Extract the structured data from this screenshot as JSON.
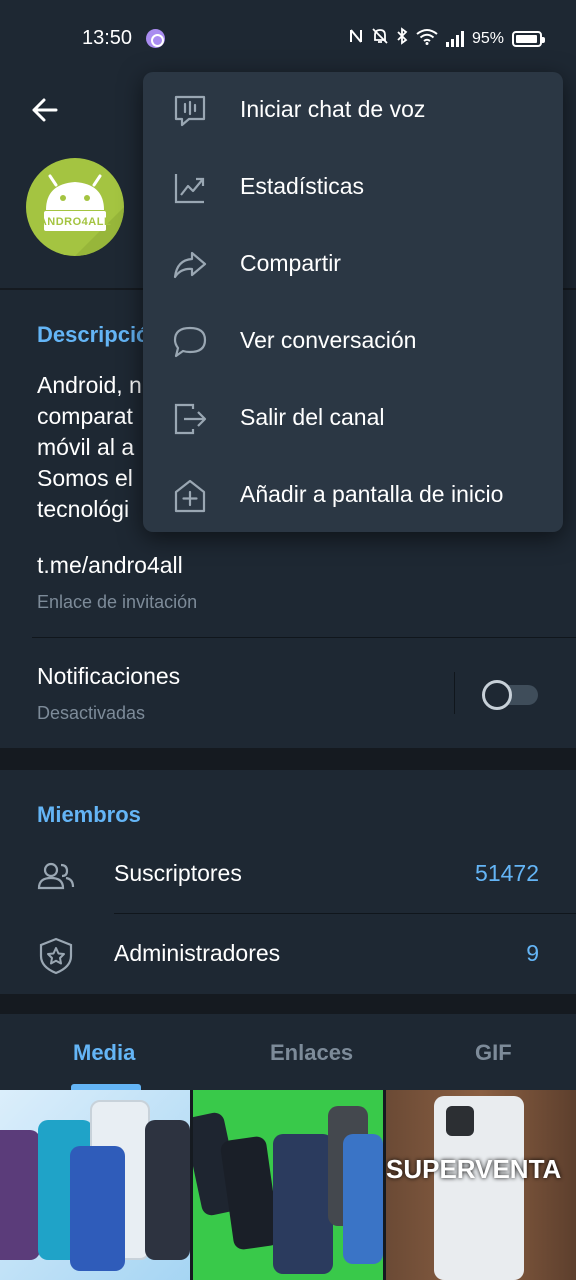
{
  "status_bar": {
    "time": "13:50",
    "battery": "95%"
  },
  "channel": {
    "avatar_text": "ANDRO4ALL",
    "description_title": "Descripció",
    "description_lines": [
      "Android, n",
      "comparat",
      "móvil al a",
      "Somos el",
      "tecnológi"
    ],
    "link": "t.me/andro4all",
    "link_sub": "Enlace de invitación",
    "notifications_label": "Notificaciones",
    "notifications_sub": "Desactivadas"
  },
  "members": {
    "title": "Miembros",
    "rows": [
      {
        "label": "Suscriptores",
        "count": "51472",
        "icon": "users-icon"
      },
      {
        "label": "Administradores",
        "count": "9",
        "icon": "shield-star-icon"
      }
    ]
  },
  "tabs": {
    "items": [
      "Media",
      "Enlaces",
      "GIF"
    ],
    "active": "Media"
  },
  "media": {
    "overlay_text": "SUPERVENTA"
  },
  "menu": {
    "items": [
      {
        "label": "Iniciar chat de voz",
        "icon": "voice-chat-icon"
      },
      {
        "label": "Estadísticas",
        "icon": "statistics-icon"
      },
      {
        "label": "Compartir",
        "icon": "share-icon"
      },
      {
        "label": "Ver conversación",
        "icon": "chat-bubble-icon"
      },
      {
        "label": "Salir del canal",
        "icon": "leave-icon"
      },
      {
        "label": "Añadir a pantalla de inicio",
        "icon": "add-home-icon"
      }
    ]
  },
  "colors": {
    "accent": "#64b5f6",
    "surface": "#1e2833",
    "menu": "#2b3744",
    "background": "#151a20"
  }
}
